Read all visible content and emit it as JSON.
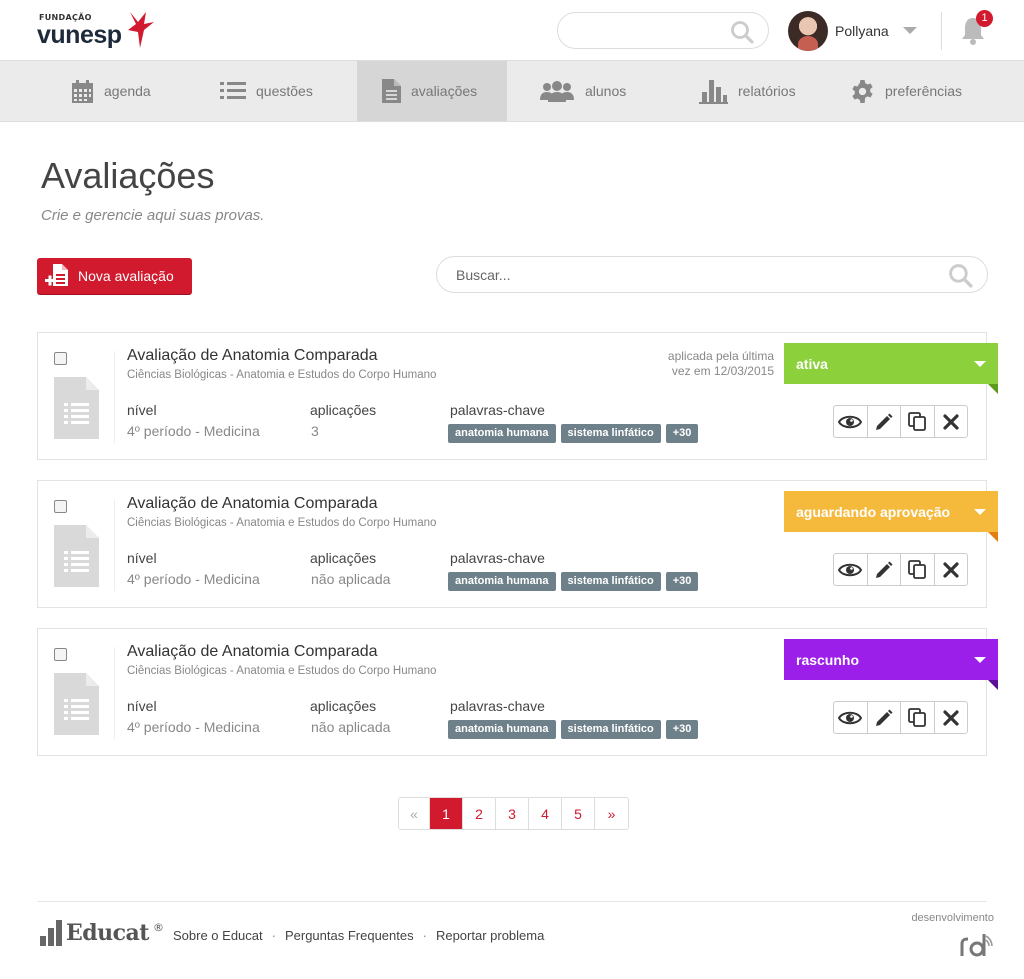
{
  "header": {
    "logo_small": "FUNDAÇÃO",
    "logo_name": "vunesp",
    "search_placeholder": "",
    "user_name": "Pollyana",
    "notifications_count": "1"
  },
  "nav": {
    "items": [
      {
        "label": "agenda",
        "icon": "calendar-icon"
      },
      {
        "label": "questões",
        "icon": "list-icon"
      },
      {
        "label": "avaliações",
        "icon": "document-icon",
        "active": true
      },
      {
        "label": "alunos",
        "icon": "users-icon"
      },
      {
        "label": "relatórios",
        "icon": "bar-chart-icon"
      },
      {
        "label": "preferências",
        "icon": "gear-icon"
      }
    ]
  },
  "page": {
    "title": "Avaliações",
    "subtitle": "Crie e gerencie aqui suas provas.",
    "new_button": "Nova avaliação",
    "search_placeholder": "Buscar..."
  },
  "labels": {
    "level": "nível",
    "applications": "aplicações",
    "keywords": "palavras-chave"
  },
  "assessments": [
    {
      "title": "Avaliação de Anatomia Comparada",
      "subject": "Ciências Biológicas - Anatomia e Estudos do Corpo Humano",
      "applied_line1": "aplicada pela última",
      "applied_line2": "vez em 12/03/2015",
      "level": "4º período - Medicina",
      "applications": "3",
      "tags": [
        "anatomia humana",
        "sistema linfático",
        "+30"
      ],
      "status": "ativa",
      "status_color": "#8cd03c",
      "status_fold": "#5e9a1c"
    },
    {
      "title": "Avaliação de Anatomia Comparada",
      "subject": "Ciências Biológicas - Anatomia e Estudos do Corpo Humano",
      "applied_line1": "",
      "applied_line2": "",
      "level": "4º período - Medicina",
      "applications": "não aplicada",
      "tags": [
        "anatomia humana",
        "sistema linfático",
        "+30"
      ],
      "status": "aguardando aprovação",
      "status_color": "#f5b93b",
      "status_fold": "#e67d10"
    },
    {
      "title": "Avaliação de Anatomia Comparada",
      "subject": "Ciências Biológicas - Anatomia e Estudos do Corpo Humano",
      "applied_line1": "",
      "applied_line2": "",
      "level": "4º período - Medicina",
      "applications": "não aplicada",
      "tags": [
        "anatomia humana",
        "sistema linfático",
        "+30"
      ],
      "status": "rascunho",
      "status_color": "#9b1fe8",
      "status_fold": "#5c1194"
    }
  ],
  "pagination": {
    "prev": "«",
    "pages": [
      "1",
      "2",
      "3",
      "4",
      "5"
    ],
    "current": "1",
    "next": "»"
  },
  "footer": {
    "brand": "Educat",
    "reg": "®",
    "links": [
      "Sobre o Educat",
      "Perguntas Frequentes",
      "Reportar problema"
    ],
    "dev_label": "desenvolvimento",
    "dev_brand": "rd"
  },
  "colors": {
    "brand": "#d11a2e",
    "nav_bg": "#ebebeb",
    "nav_active": "#d6d6d6",
    "tag_bg": "#6e8089"
  }
}
